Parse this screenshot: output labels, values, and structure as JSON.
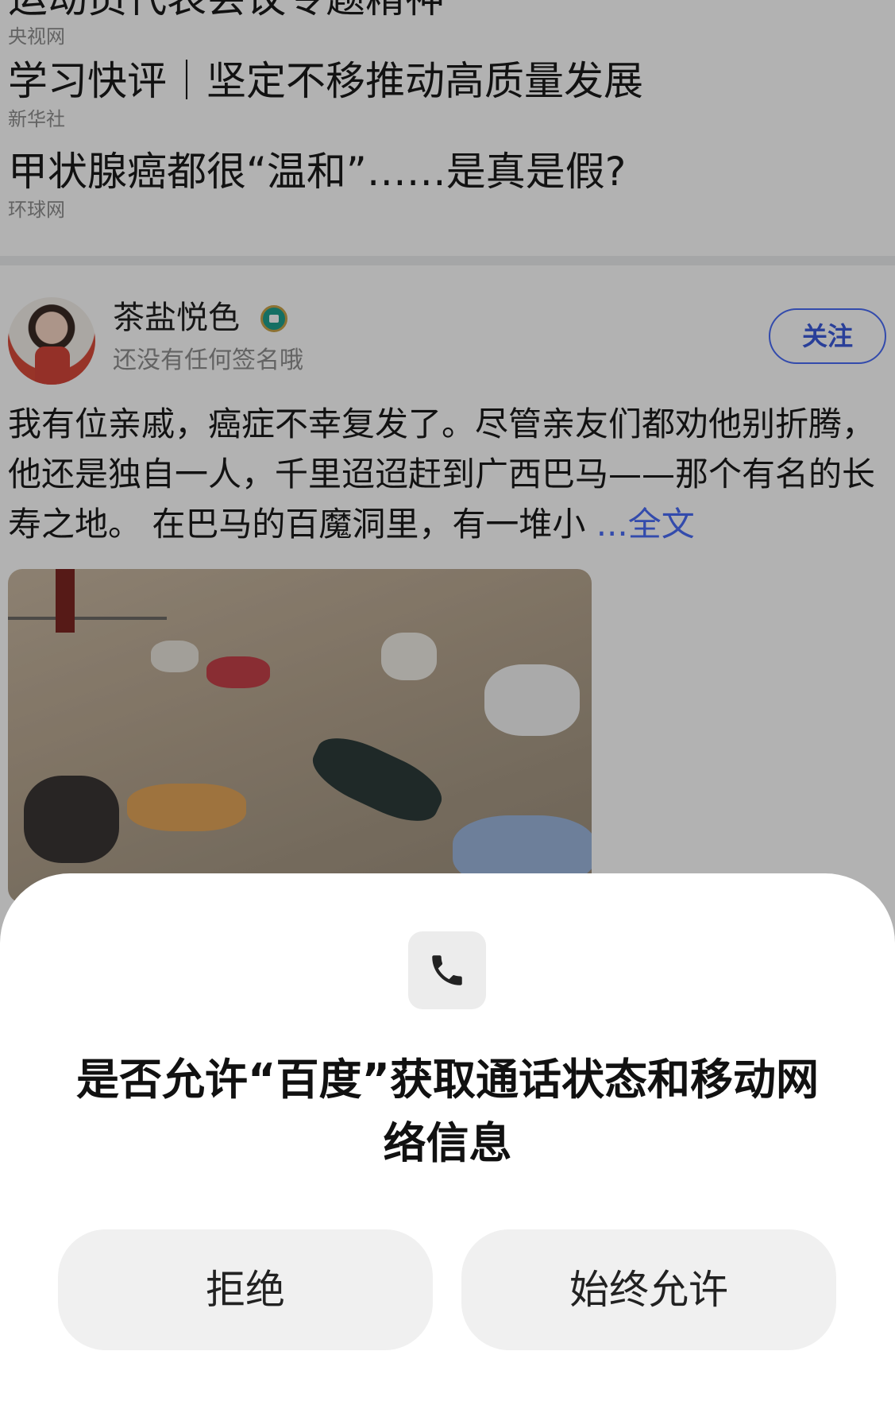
{
  "news": [
    {
      "title": "运动员代表会议专题精神",
      "source": "央视网"
    },
    {
      "title": "学习快评｜坚定不移推动高质量发展",
      "source": "新华社"
    },
    {
      "title": "甲状腺癌都很“温和”……是真是假?",
      "source": "环球网"
    }
  ],
  "post": {
    "author": "茶盐悦色",
    "signature": "还没有任何签名哦",
    "follow_label": "关注",
    "text": "我有位亲戚，癌症不幸复发了。尽管亲友们都劝他别折腾，他还是独自一人，千里迢迢赶到广西巴马——那个有名的长寿之地。 在巴马的百魔洞里，有一堆小 ",
    "more_label": "...全文"
  },
  "dialog": {
    "icon": "phone-icon",
    "title": "是否允许“百度”获取通话状态和移动网络信息",
    "deny_label": "拒绝",
    "allow_label": "始终允许"
  },
  "colors": {
    "accent": "#4a6cf7",
    "scrim": "rgba(0,0,0,0.30)",
    "dialog_bg": "#ffffff",
    "button_bg": "#f0f0f0"
  }
}
